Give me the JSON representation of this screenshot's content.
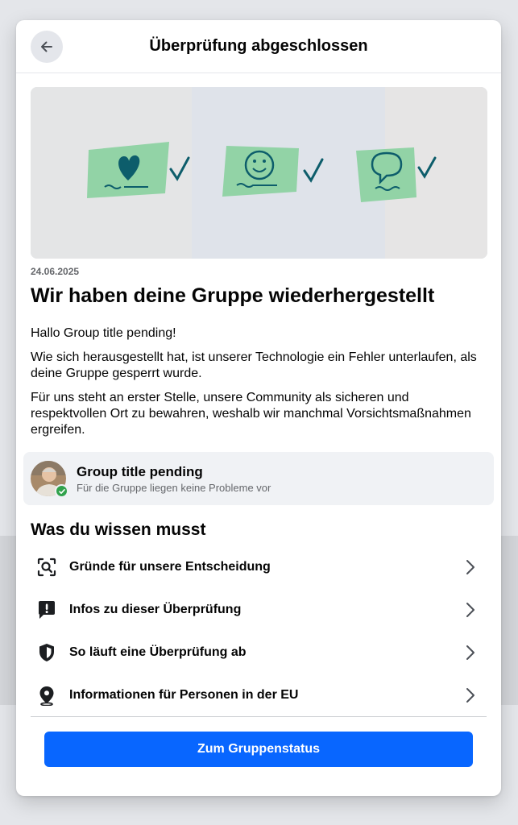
{
  "dialog": {
    "title": "Überprüfung abgeschlossen",
    "back_icon": "arrow-left-icon"
  },
  "hero": {
    "image": "illustration-sticky-notes-checkmarks",
    "icons": [
      "heart-icon",
      "smiley-icon",
      "speech-bubble-icon"
    ]
  },
  "notice": {
    "date": "24.06.2025",
    "title": "Wir haben deine Gruppe wiederhergestellt",
    "paragraphs": [
      "Hallo Group title pending!",
      "Wie sich herausgestellt hat, ist unserer Technologie ein Fehler unterlaufen, als deine Gruppe gesperrt wurde.",
      "Für uns steht an erster Stelle, unsere Community als sicheren und respektvollen Ort zu bewahren, weshalb wir manchmal Vorsichtsmaßnahmen ergreifen."
    ]
  },
  "group": {
    "name": "Group title pending",
    "status": "Für die Gruppe liegen keine Probleme vor",
    "badge_color": "#31a24c"
  },
  "info": {
    "section_title": "Was du wissen musst",
    "items": [
      {
        "label": "Gründe für unsere Entscheidung",
        "icon": "search-scan-icon"
      },
      {
        "label": "Infos zu dieser Überprüfung",
        "icon": "alert-message-icon"
      },
      {
        "label": "So läuft eine Überprüfung ab",
        "icon": "shield-icon"
      },
      {
        "label": "Informationen für Personen in der EU",
        "icon": "location-pin-icon"
      }
    ]
  },
  "footer": {
    "button_label": "Zum Gruppenstatus",
    "accent": "#0866ff"
  }
}
